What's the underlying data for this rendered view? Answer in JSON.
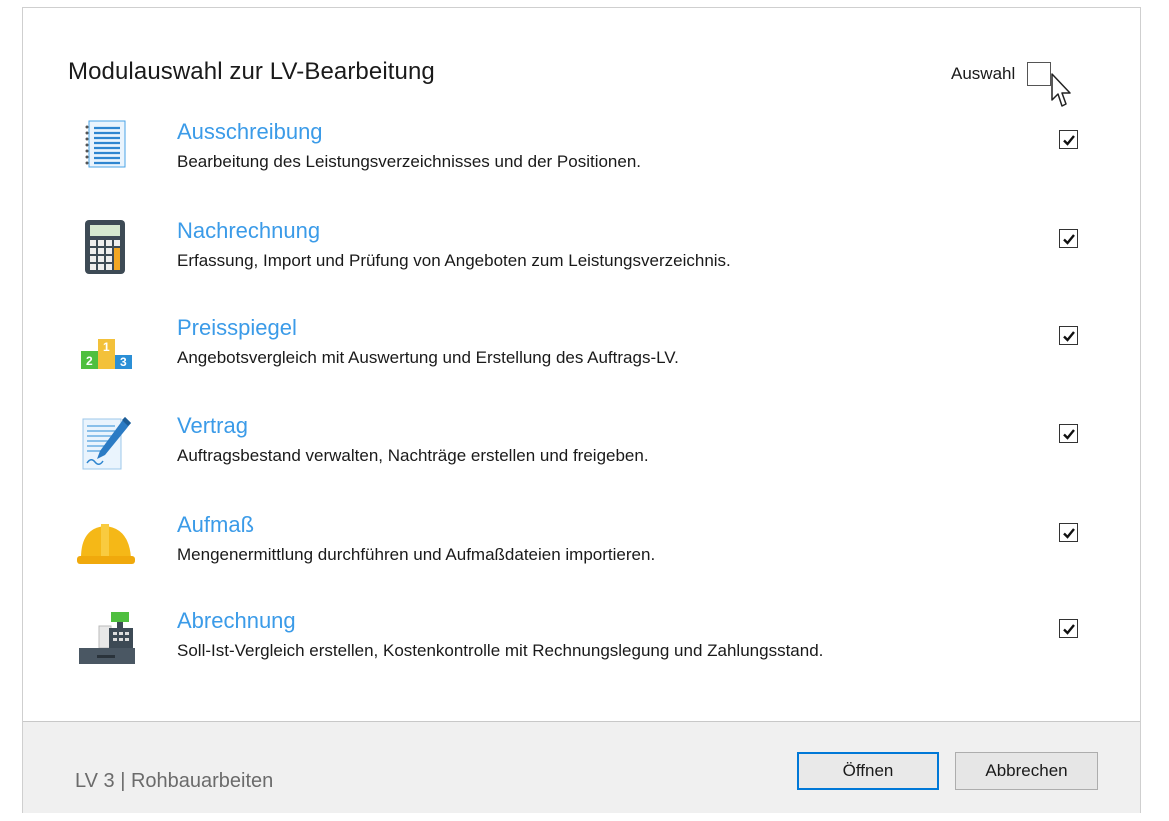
{
  "dialog": {
    "title": "Modulauswahl zur LV-Bearbeitung",
    "select_all": {
      "label": "Auswahl",
      "checked": false
    }
  },
  "modules": [
    {
      "name": "Ausschreibung",
      "description": "Bearbeitung des Leistungsverzeichnisses und der Positionen.",
      "icon": "document-list-icon",
      "checked": true
    },
    {
      "name": "Nachrechnung",
      "description": "Erfassung, Import und Prüfung von Angeboten zum Leistungsverzeichnis.",
      "icon": "calculator-icon",
      "checked": true
    },
    {
      "name": "Preisspiegel",
      "description": "Angebotsvergleich mit Auswertung und Erstellung des Auftrags-LV.",
      "icon": "podium-icon",
      "checked": true,
      "podium_labels": [
        "2",
        "1",
        "3"
      ]
    },
    {
      "name": "Vertrag",
      "description": "Auftragsbestand verwalten, Nachträge erstellen und freigeben.",
      "icon": "contract-pen-icon",
      "checked": true
    },
    {
      "name": "Aufmaß",
      "description": "Mengenermittlung durchführen und Aufmaßdateien importieren.",
      "icon": "hardhat-icon",
      "checked": true
    },
    {
      "name": "Abrechnung",
      "description": "Soll-Ist-Vergleich erstellen, Kostenkontrolle mit Rechnungslegung und Zahlungsstand.",
      "icon": "cash-register-icon",
      "checked": true
    }
  ],
  "footer": {
    "project_label": "LV 3 | Rohbauarbeiten",
    "open_button": "Öffnen",
    "cancel_button": "Abbrechen"
  },
  "colors": {
    "module_title": "#3b9be8",
    "primary_border": "#0078d7"
  }
}
